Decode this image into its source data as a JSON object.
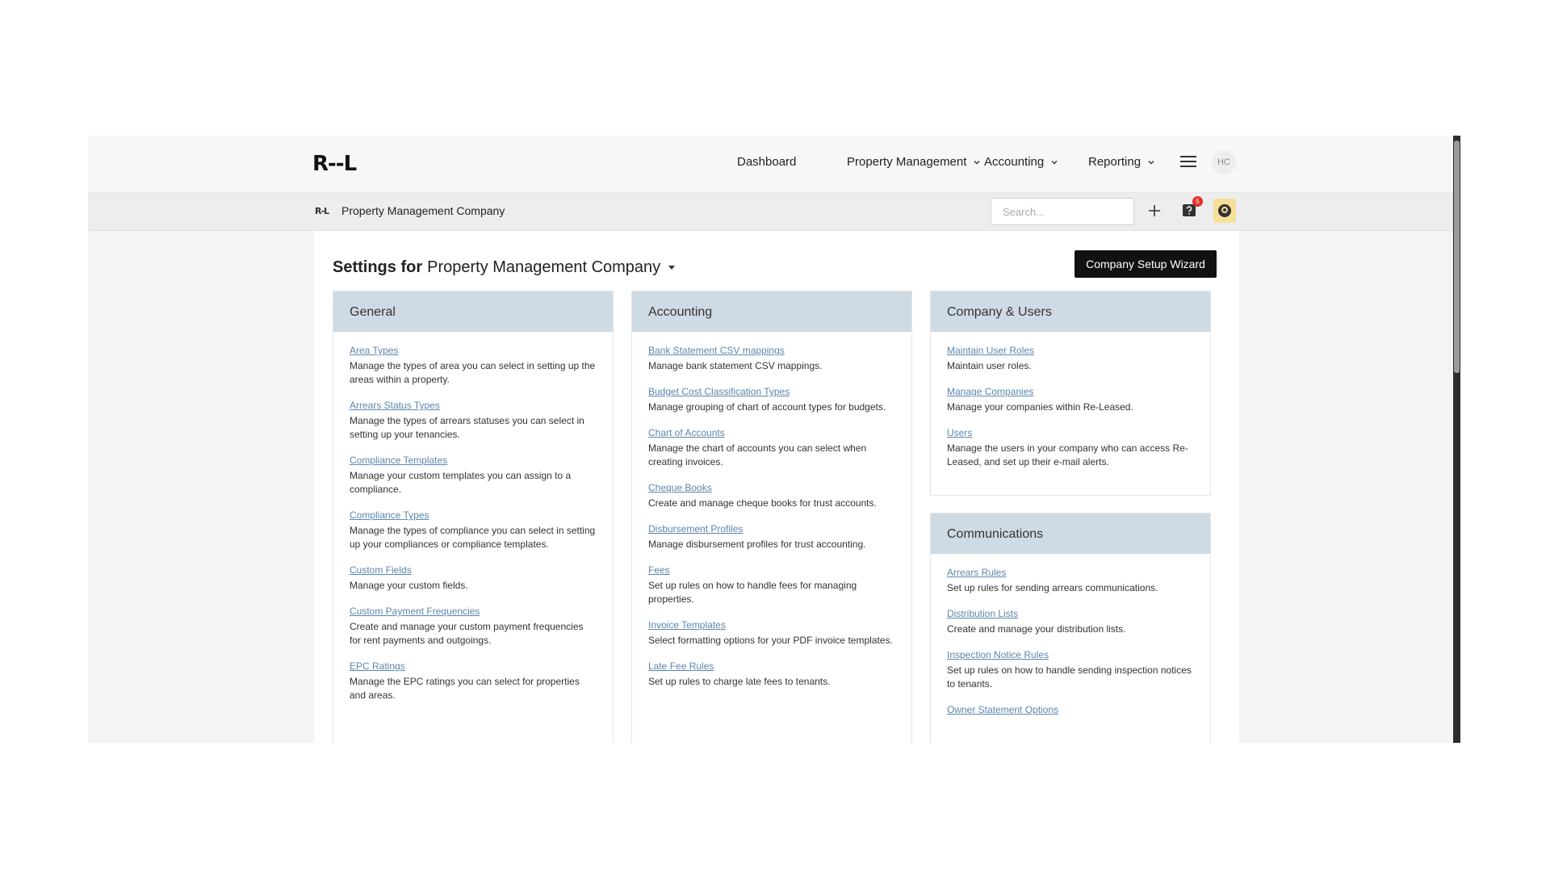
{
  "nav": {
    "logo": "R-‑L",
    "dashboard": "Dashboard",
    "property_management": "Property Management",
    "accounting": "Accounting",
    "reporting": "Reporting",
    "avatar": "HC"
  },
  "subbar": {
    "company_logo": "R-L",
    "company_name": "Property Management Company",
    "search_placeholder": "Search...",
    "notification_count": "5"
  },
  "page": {
    "title_prefix": "Settings for",
    "company": "Property Management Company",
    "wizard_button": "Company Setup Wizard"
  },
  "general": {
    "title": "General",
    "items": [
      {
        "label": "Area Types",
        "desc": "Manage the types of area you can select in setting up the areas within a property."
      },
      {
        "label": "Arrears Status Types",
        "desc": "Manage the types of arrears statuses you can select in setting up your tenancies."
      },
      {
        "label": "Compliance Templates",
        "desc": "Manage your custom templates you can assign to a compliance."
      },
      {
        "label": "Compliance Types",
        "desc": "Manage the types of compliance you can select in setting up your compliances or compliance templates."
      },
      {
        "label": "Custom Fields",
        "desc": "Manage your custom fields."
      },
      {
        "label": "Custom Payment Frequencies",
        "desc": "Create and manage your custom payment frequencies for rent payments and outgoings."
      },
      {
        "label": "EPC Ratings",
        "desc": "Manage the EPC ratings you can select for properties and areas."
      }
    ]
  },
  "accounting": {
    "title": "Accounting",
    "items": [
      {
        "label": "Bank Statement CSV mappings",
        "desc": "Manage bank statement CSV mappings."
      },
      {
        "label": "Budget Cost Classification Types",
        "desc": "Manage grouping of chart of account types for budgets."
      },
      {
        "label": "Chart of Accounts",
        "desc": "Manage the chart of accounts you can select when creating invoices."
      },
      {
        "label": "Cheque Books",
        "desc": "Create and manage cheque books for trust accounts."
      },
      {
        "label": "Disbursement Profiles",
        "desc": "Manage disbursement profiles for trust accounting."
      },
      {
        "label": "Fees",
        "desc": "Set up rules on how to handle fees for managing properties."
      },
      {
        "label": "Invoice Templates",
        "desc": "Select formatting options for your PDF invoice templates."
      },
      {
        "label": "Late Fee Rules",
        "desc": "Set up rules to charge late fees to tenants."
      }
    ]
  },
  "company_users": {
    "title": "Company & Users",
    "items": [
      {
        "label": "Maintain User Roles",
        "desc": "Maintain user roles."
      },
      {
        "label": "Manage Companies",
        "desc": "Manage your companies within Re-Leased."
      },
      {
        "label": "Users",
        "desc": "Manage the users in your company who can access Re-Leased, and set up their e-mail alerts."
      }
    ]
  },
  "communications": {
    "title": "Communications",
    "items": [
      {
        "label": "Arrears Rules",
        "desc": "Set up rules for sending arrears communications."
      },
      {
        "label": "Distribution Lists",
        "desc": "Create and manage your distribution lists."
      },
      {
        "label": "Inspection Notice Rules",
        "desc": "Set up rules on how to handle sending inspection notices to tenants."
      },
      {
        "label": "Owner Statement Options",
        "desc": ""
      }
    ]
  }
}
